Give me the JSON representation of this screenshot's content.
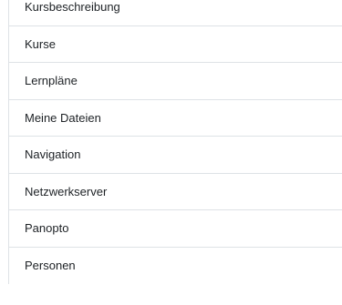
{
  "block_list": {
    "items": [
      {
        "label": "Kursbeschreibung"
      },
      {
        "label": "Kurse"
      },
      {
        "label": "Lernpläne"
      },
      {
        "label": "Meine Dateien"
      },
      {
        "label": "Navigation"
      },
      {
        "label": "Netzwerkserver"
      },
      {
        "label": "Panopto"
      },
      {
        "label": "Personen"
      }
    ]
  }
}
